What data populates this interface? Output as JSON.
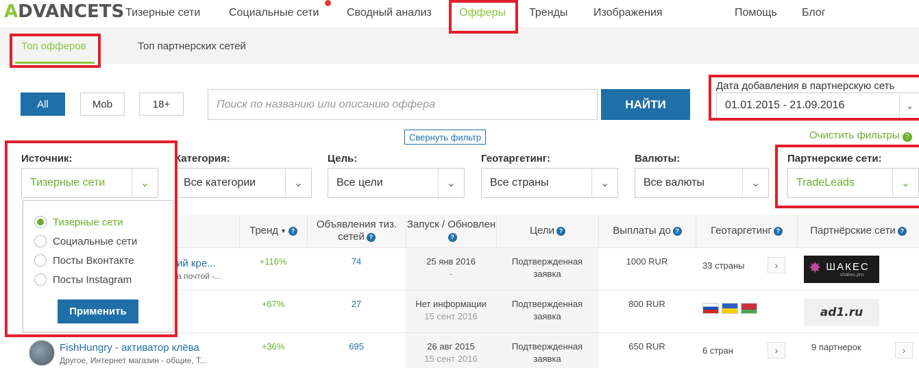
{
  "logo": {
    "first": "A",
    "rest": "DVANCETS"
  },
  "nav": {
    "items": [
      "Тизерные сети",
      "Социальные сети",
      "Сводный анализ",
      "Офферы",
      "Тренды",
      "Изображения",
      "Помощь",
      "Блог"
    ]
  },
  "subnav": {
    "items": [
      "Топ офферов",
      "Топ партнерских сетей"
    ]
  },
  "filters": {
    "buttons": [
      "All",
      "Mob",
      "18+"
    ],
    "search_placeholder": "Поиск по названию или описанию оффера",
    "search_button": "НАЙТИ",
    "date_label": "Дата добавления в партнерскую сеть",
    "date_value": "01.01.2015 - 21.09.2016",
    "collapse": "Свернуть фильтр",
    "clear": "Очистить фильтры",
    "labels": [
      "Источник:",
      "Категория:",
      "Цель:",
      "Геотаргетинг:",
      "Валюты:",
      "Партнерские сети:"
    ],
    "values": [
      "Тизерные сети",
      "Все категории",
      "Все цели",
      "Все страны",
      "Все валюты",
      "TradeLeads"
    ]
  },
  "source_dropdown": {
    "options": [
      "Тизерные сети",
      "Социальные сети",
      "Посты Вконтакте",
      "Посты Instagram"
    ],
    "selected": "Тизерные сети",
    "apply": "Применить"
  },
  "table": {
    "headers": [
      "Тренд",
      "Объявления тиз. сетей",
      "Запуск / Обновлен",
      "Цели",
      "Выплаты до",
      "Геотаргетинг",
      "Партнёрские сети"
    ],
    "rows": [
      {
        "title": "ий кре...",
        "subtitle": "а почтой -...",
        "trend": "+116%",
        "ads": "74",
        "launch": "25 янв 2016",
        "updated": "-",
        "goal1": "Подтвержденная",
        "goal2": "заявка",
        "payout": "1000 RUR",
        "geo": "33 страны",
        "network": "ШАКЕС",
        "network_sub": "shakes.pro"
      },
      {
        "title": "",
        "subtitle": "",
        "trend": "+67%",
        "ads": "27",
        "launch": "Нет информации",
        "updated": "15 сент 2016",
        "goal1": "Подтвержденная",
        "goal2": "заявка",
        "payout": "800 RUR",
        "geo": "",
        "network": "ad1.ru",
        "network_sub": ""
      },
      {
        "title": "FishHungry - активатор клёва",
        "subtitle": "Другое, Интернет магазин - общие, Т...",
        "trend": "+36%",
        "ads": "695",
        "launch": "26 авг 2015",
        "updated": "15 сент 2016",
        "goal1": "Подтвержденная",
        "goal2": "заявка",
        "payout": "650 RUR",
        "geo": "6 стран",
        "network": "9 партнерок",
        "network_sub": ""
      }
    ]
  },
  "colors": {
    "accent_green": "#8cc63f",
    "primary_blue": "#1f6fa8",
    "highlight_red": "#e0202a"
  }
}
